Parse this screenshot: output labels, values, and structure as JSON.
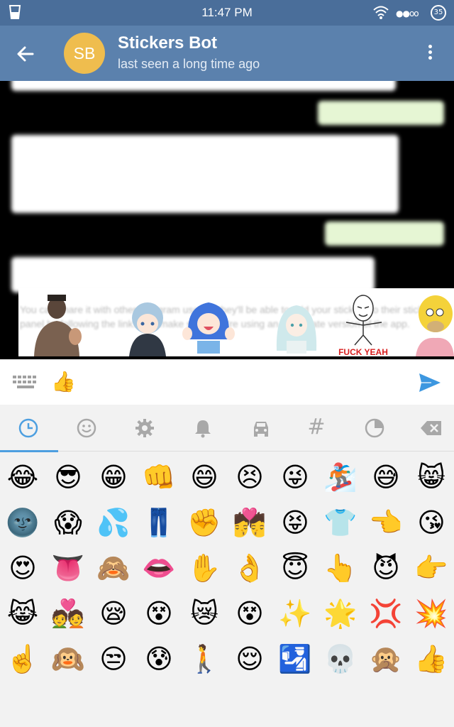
{
  "status_bar": {
    "time": "11:47 PM",
    "signal": "●●oo",
    "battery": "35"
  },
  "header": {
    "avatar_initials": "SB",
    "title": "Stickers Bot",
    "subtitle": "last seen a long time ago"
  },
  "chat": {
    "messages": [
      {
        "direction": "in",
        "text": ""
      },
      {
        "direction": "out",
        "text": ""
      },
      {
        "direction": "in",
        "text": ""
      },
      {
        "direction": "out",
        "text": ""
      },
      {
        "direction": "in",
        "text": ""
      }
    ],
    "ghost_text": "You can share it with other Telegram users – they'll be able to add your stickers to their sticker panel by following the link. Just make sure they're using an up to date version of the app."
  },
  "sticker_suggestions": [
    {
      "name": "muscle-man-sticker",
      "color": "#6a5a4e"
    },
    {
      "name": "blue-hair-anime-sticker",
      "color": "#9ec0dc"
    },
    {
      "name": "blue-hair-girl-thumbs-sticker",
      "color": "#4a7ee0"
    },
    {
      "name": "white-hair-girl-sticker",
      "color": "#bfe3e8"
    },
    {
      "name": "rage-face-sticker",
      "color": "#333333",
      "caption": "FUCK YEAH"
    },
    {
      "name": "homer-sticker",
      "color": "#f4d23a"
    }
  ],
  "input_bar": {
    "emoji_selected": "👍"
  },
  "emoji_tabs": [
    {
      "name": "recent-tab",
      "icon": "clock-icon",
      "active": true
    },
    {
      "name": "smileys-tab",
      "icon": "smile-icon",
      "active": false
    },
    {
      "name": "objects-tab",
      "icon": "gear-icon",
      "active": false
    },
    {
      "name": "notifications-tab",
      "icon": "bell-icon",
      "active": false
    },
    {
      "name": "travel-tab",
      "icon": "car-icon",
      "active": false
    },
    {
      "name": "symbols-tab",
      "icon": "hash-icon",
      "glyph": "#",
      "active": false
    },
    {
      "name": "nature-tab",
      "icon": "moon-icon",
      "active": false
    },
    {
      "name": "backspace-tab",
      "icon": "backspace-icon",
      "active": false
    }
  ],
  "emoji_grid": [
    [
      "😂",
      "😎",
      "😁",
      "👊",
      "😄",
      "😣",
      "😜",
      "🏂",
      "😅",
      "😸"
    ],
    [
      "🌚",
      "😱",
      "💦",
      "👖",
      "✊",
      "💏",
      "😝",
      "👕",
      "👈",
      "😘"
    ],
    [
      "😍",
      "👅",
      "🙈",
      "👄",
      "✋",
      "👌",
      "😇",
      "👆",
      "😈",
      "👉"
    ],
    [
      "😹",
      "💑",
      "😪",
      "😵",
      "😿",
      "😵",
      "✨",
      "🌟",
      "💢",
      "💥"
    ],
    [
      "☝️",
      "🙉",
      "😒",
      "😰",
      "🚶",
      "😌",
      "🛂",
      "💀",
      "🙊",
      "👍"
    ]
  ],
  "colors": {
    "status_bar": "#4a6e9a",
    "header": "#5b81ad",
    "avatar": "#efbd4e",
    "accent": "#4d9fe0",
    "send": "#3d97e0"
  }
}
